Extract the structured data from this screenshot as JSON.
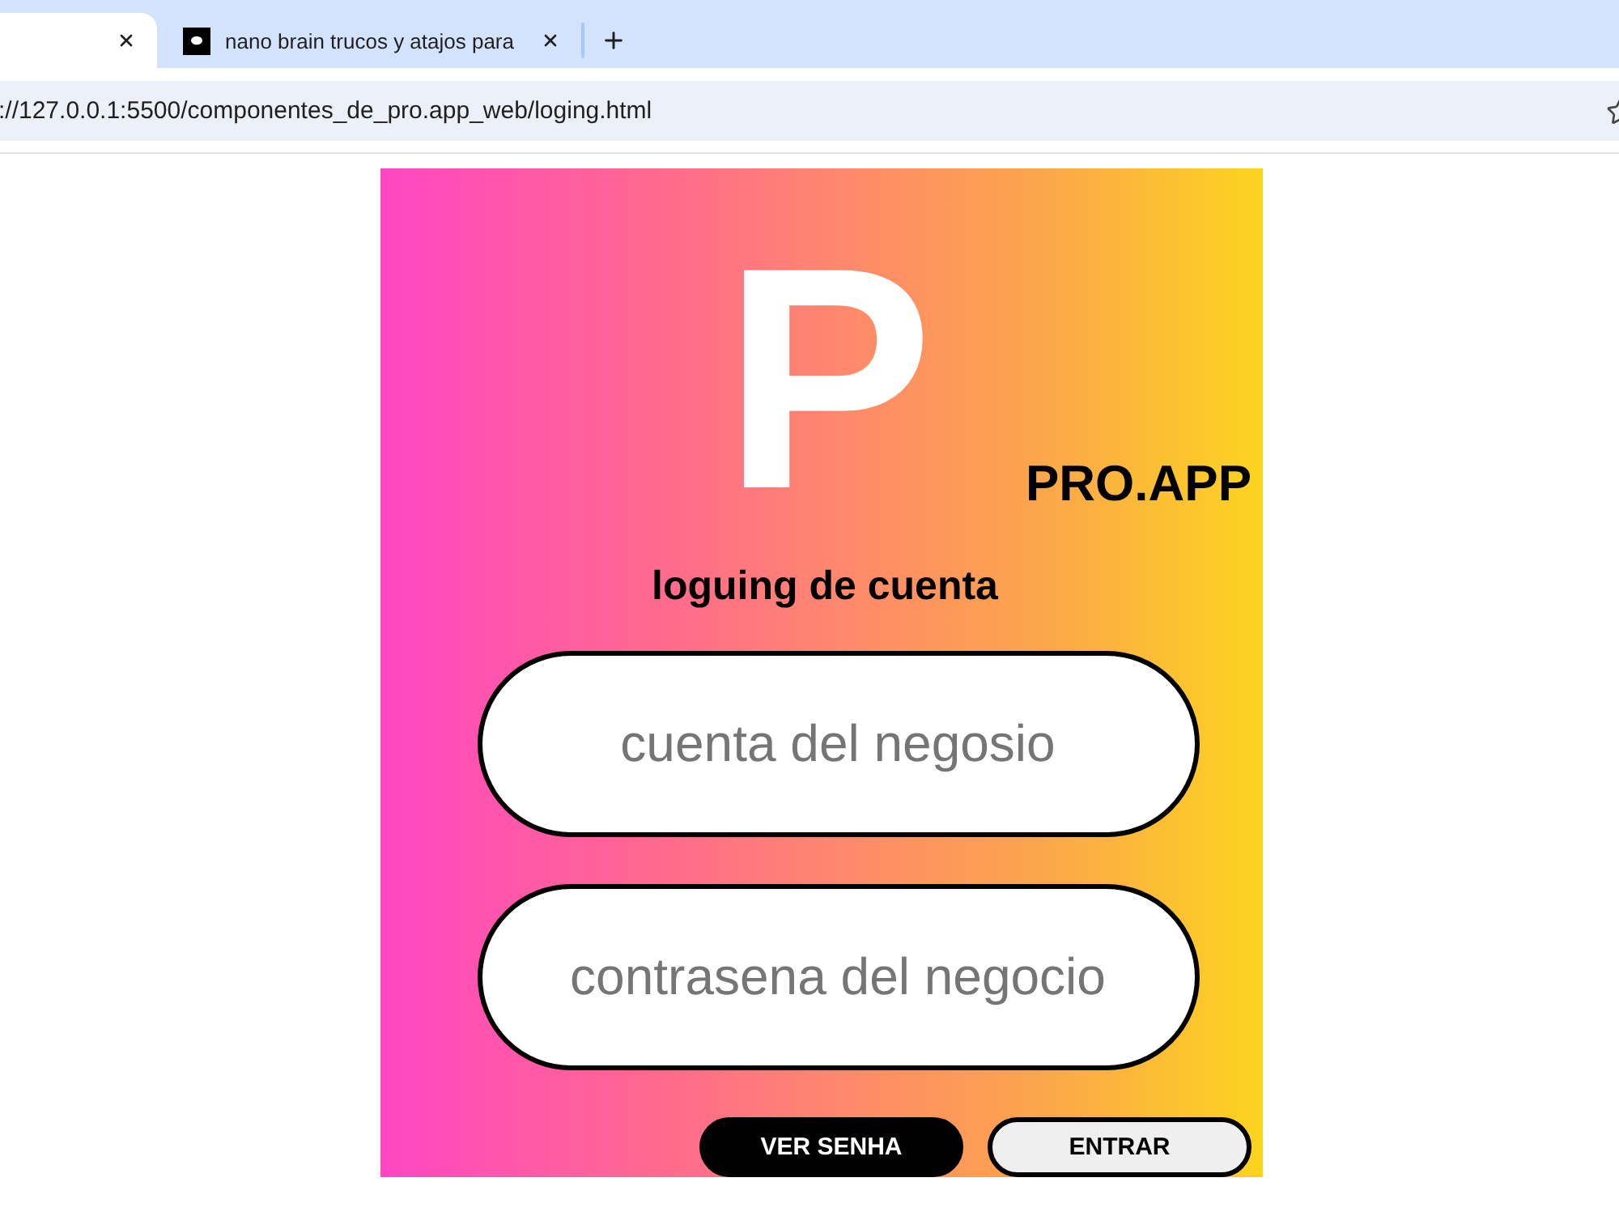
{
  "browser": {
    "tabs": [
      {
        "selected": true
      },
      {
        "title": "nano brain trucos y atajos para",
        "selected": false
      }
    ],
    "address": "://127.0.0.1:5500/componentes_de_pro.app_web/loging.html"
  },
  "login": {
    "logo_letter": "P",
    "brand": "PRO.APP",
    "heading": "loguing de cuenta",
    "fields": [
      {
        "placeholder": "cuenta del negosio"
      },
      {
        "placeholder": "contrasena del negocio"
      }
    ],
    "buttons": [
      {
        "label": "VER SENHA",
        "kind": "primary"
      },
      {
        "label": "ENTRAR",
        "kind": "secondary"
      }
    ]
  }
}
